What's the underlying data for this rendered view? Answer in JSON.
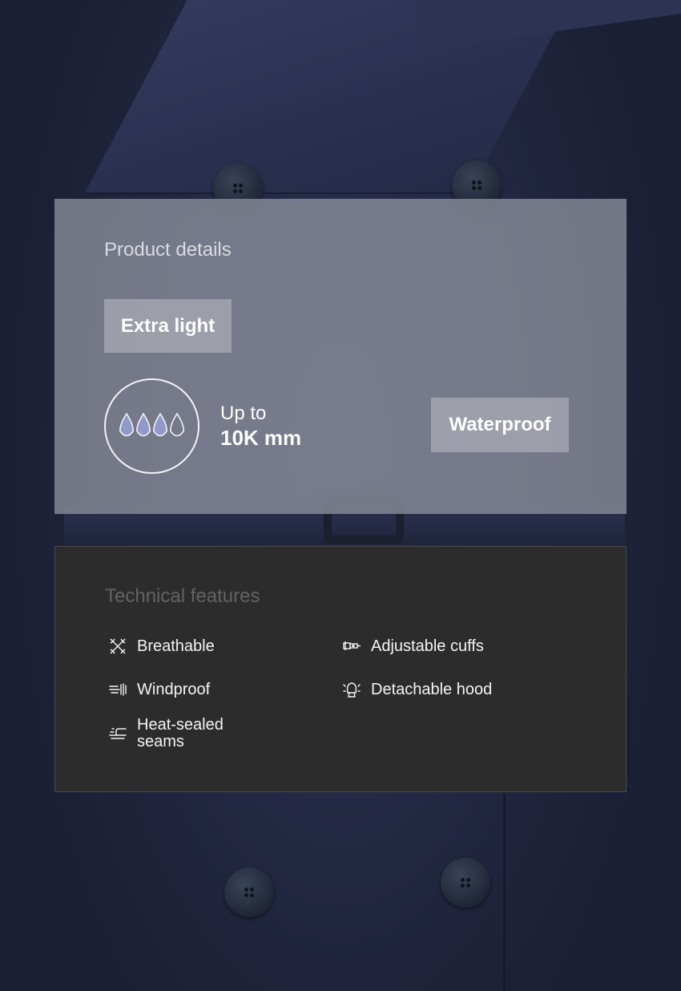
{
  "product_details": {
    "title": "Product details",
    "tag_weight": "Extra light",
    "water_rating": {
      "prefix": "Up to",
      "value": "10K mm",
      "level": 3,
      "max_level": 4
    },
    "tag_waterproof": "Waterproof"
  },
  "technical_features": {
    "title": "Technical features",
    "items": [
      {
        "label": "Breathable",
        "icon": "breathable-icon"
      },
      {
        "label": "Windproof",
        "icon": "wind-icon"
      },
      {
        "label": "Heat-sealed seams",
        "icon": "heat-sealed-seams-icon"
      },
      {
        "label": "Adjustable cuffs",
        "icon": "adjustable-cuffs-icon"
      },
      {
        "label": "Detachable hood",
        "icon": "detachable-hood-icon"
      }
    ]
  },
  "colors": {
    "details_panel": "#9698a4",
    "tech_panel": "#2c2c2d",
    "drop_fill": "#8f9ac9",
    "coat": "#232843"
  }
}
